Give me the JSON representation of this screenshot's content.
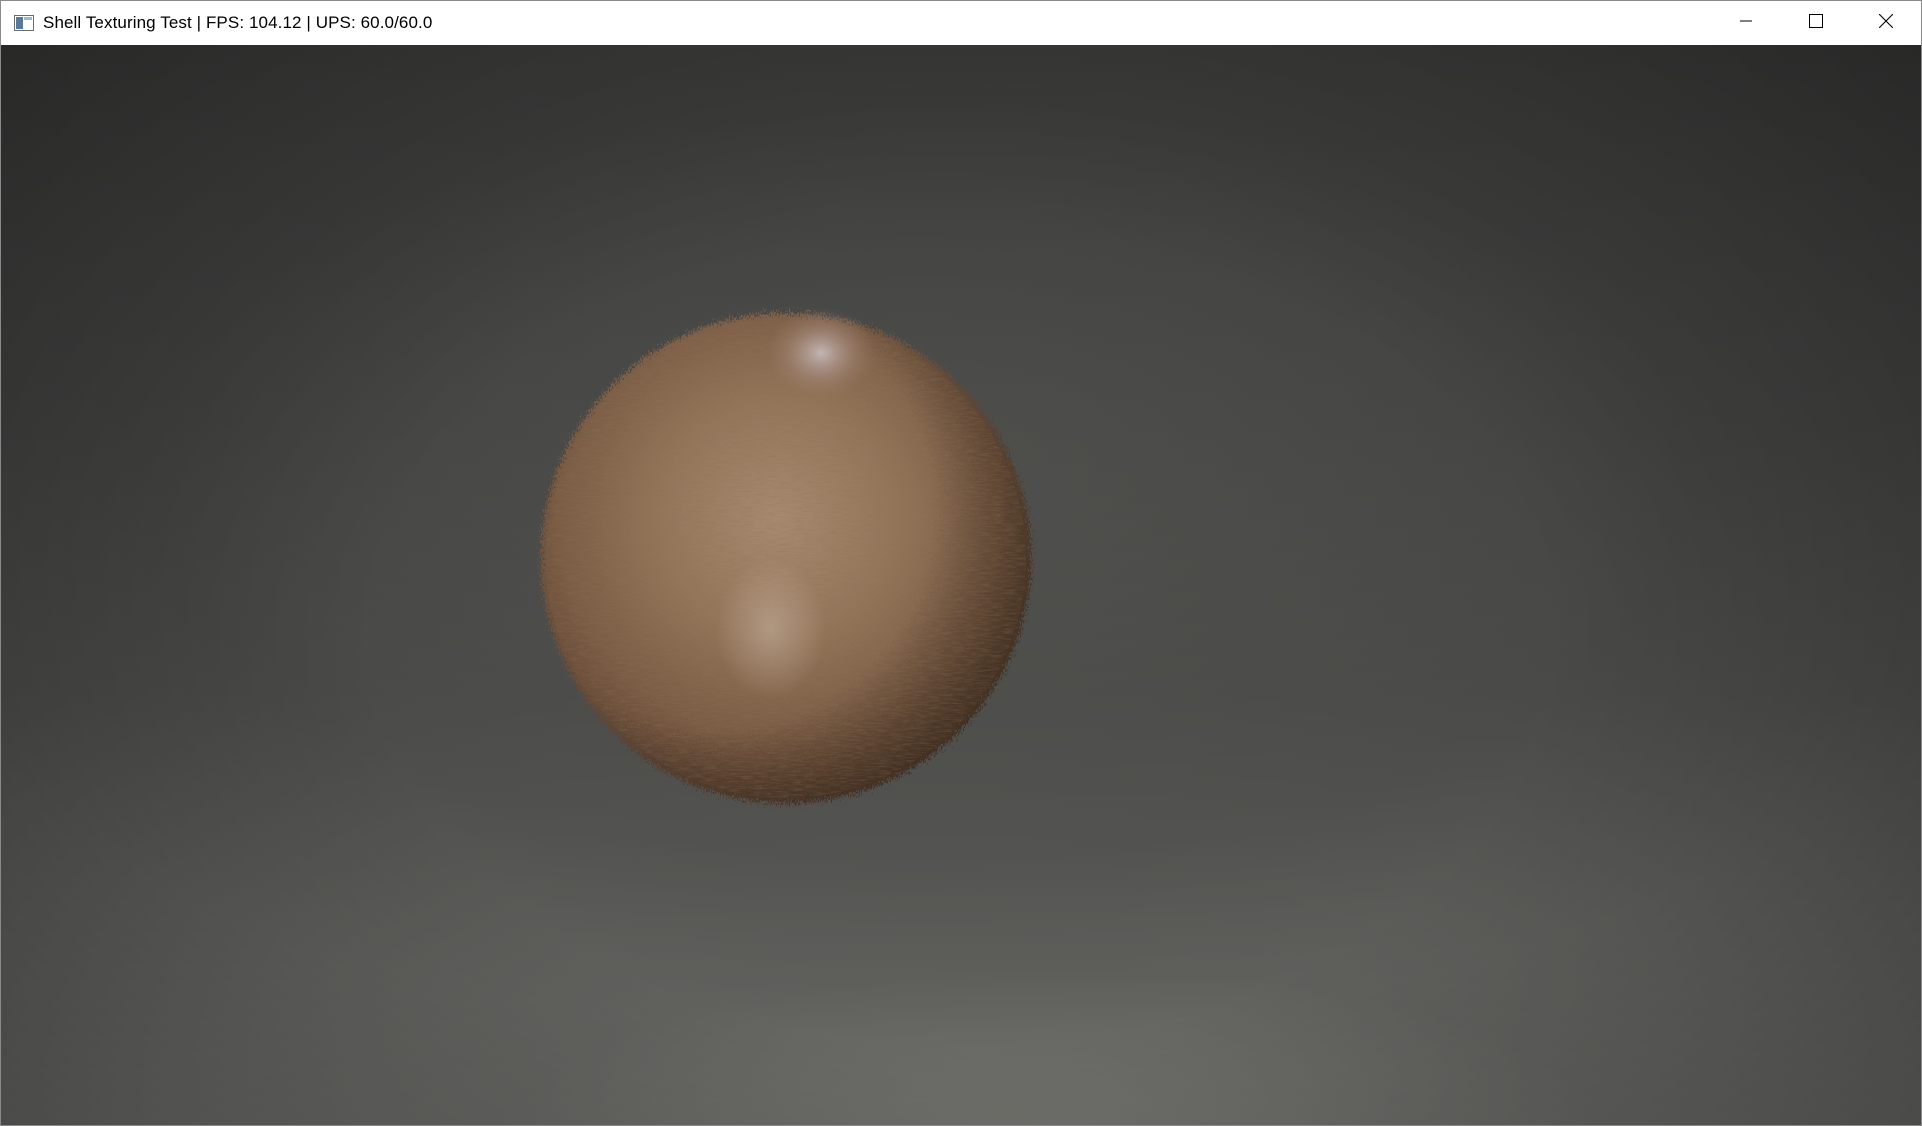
{
  "window": {
    "title": "Shell Texturing Test | FPS: 104.12 | UPS: 60.0/60.0",
    "icon": "app-window-icon",
    "controls": {
      "minimize_icon": "minimize-icon",
      "maximize_icon": "maximize-icon",
      "close_icon": "close-icon"
    }
  },
  "scene": {
    "object": "fur-sphere",
    "colors": {
      "fur_base": "#8a6a4e",
      "fur_light": "#b08f72",
      "fur_dark": "#4a3526",
      "background_top": "#3d3d3c",
      "background_bottom": "#6a6a67"
    }
  }
}
